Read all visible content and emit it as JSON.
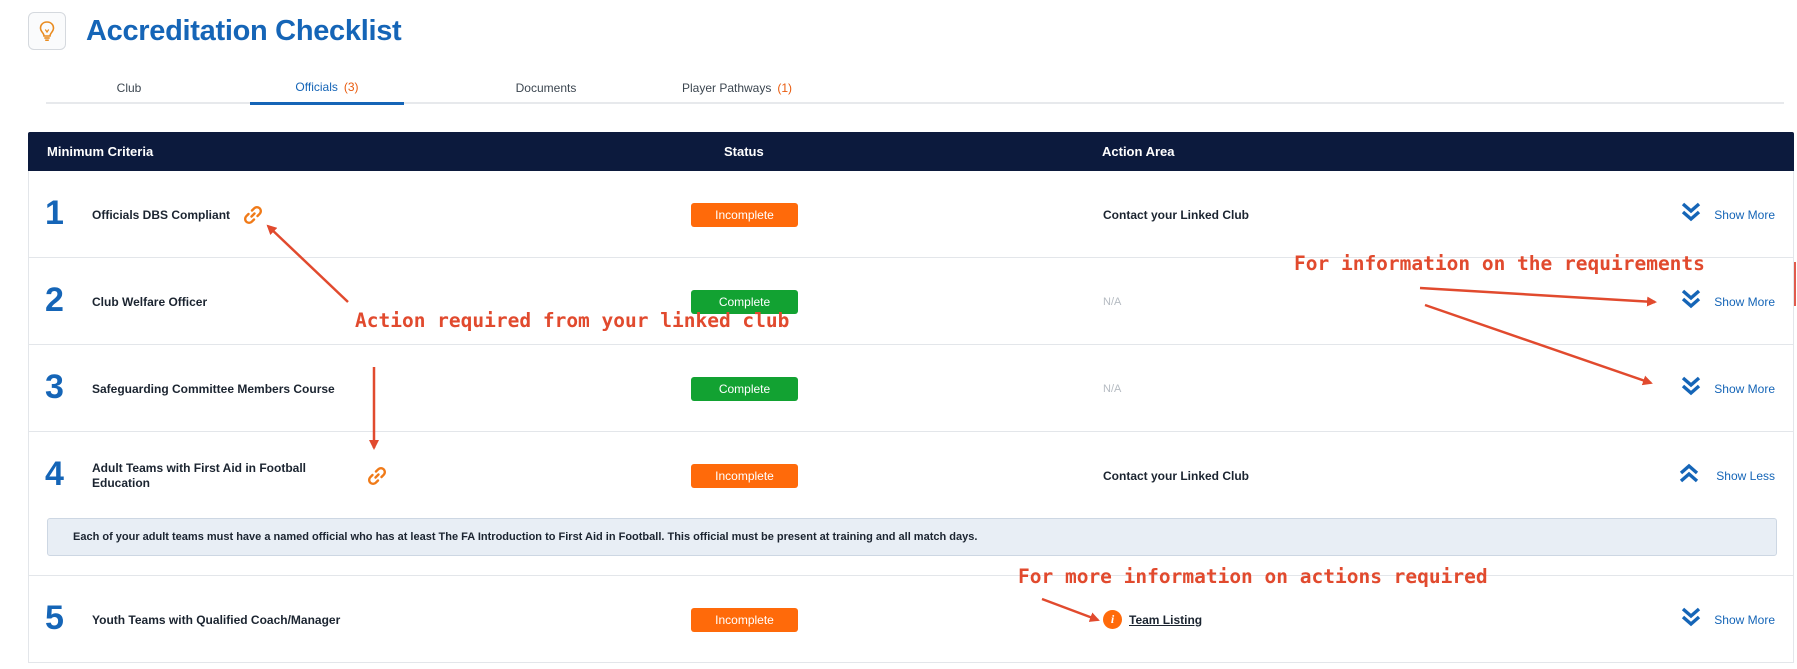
{
  "page": {
    "title": "Accreditation Checklist",
    "icon": "lightbulb-icon"
  },
  "tabs": [
    {
      "label": "Club",
      "count": ""
    },
    {
      "label": "Officials",
      "count": "(3)"
    },
    {
      "label": "Documents",
      "count": ""
    },
    {
      "label": "Player Pathways",
      "count": "(1)"
    }
  ],
  "active_tab": "Officials",
  "table": {
    "headers": {
      "criteria": "Minimum Criteria",
      "status": "Status",
      "action": "Action Area"
    },
    "rows": [
      {
        "number": "1",
        "criteria": "Officials DBS Compliant",
        "linked": true,
        "status": "Incomplete",
        "action": "Contact your Linked Club",
        "toggle": "Show More"
      },
      {
        "number": "2",
        "criteria": "Club Welfare Officer",
        "linked": false,
        "status": "Complete",
        "action": "N/A",
        "toggle": "Show More"
      },
      {
        "number": "3",
        "criteria": "Safeguarding Committee Members Course",
        "linked": false,
        "status": "Complete",
        "action": "N/A",
        "toggle": "Show More"
      },
      {
        "number": "4",
        "criteria": "Adult Teams with First Aid in Football Education",
        "linked": true,
        "status": "Incomplete",
        "action": "Contact your Linked Club",
        "toggle": "Show Less",
        "detail": "Each of your adult teams must have a named official who has at least The FA Introduction to First Aid in Football. This official must be present at training and all match days."
      },
      {
        "number": "5",
        "criteria": "Youth Teams with Qualified Coach/Manager",
        "linked": false,
        "status": "Incomplete",
        "action": "Team Listing",
        "toggle": "Show More"
      }
    ]
  },
  "annotations": {
    "linked_club": "Action required from your linked club",
    "requirements": "For information on the requirements",
    "actions": "For more information on actions required"
  },
  "colors": {
    "brand_blue": "#1565b7",
    "header_navy": "#0c1a3d",
    "incomplete_orange": "#ff6a0a",
    "complete_green": "#12a232",
    "annotation_red": "#e14a2e"
  }
}
